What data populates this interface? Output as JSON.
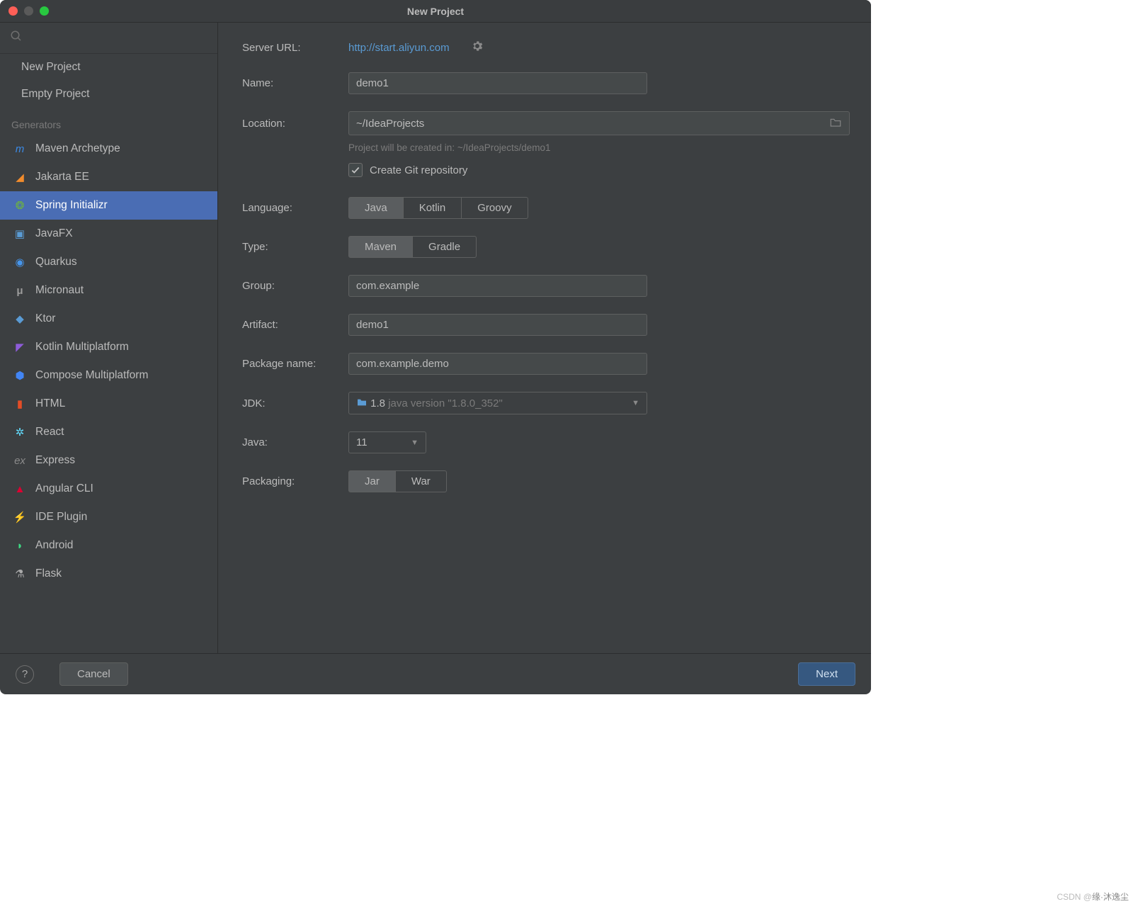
{
  "title": "New Project",
  "traffic_colors": {
    "close": "#ff5f57",
    "min": "#5a5a5a",
    "max": "#28c840"
  },
  "sidebar": {
    "items": [
      "New Project",
      "Empty Project"
    ],
    "generators_label": "Generators",
    "generators": [
      {
        "label": "Maven Archetype",
        "icon_color": "#3b8ae6",
        "glyph": "m",
        "italic": true
      },
      {
        "label": "Jakarta EE",
        "icon_color": "#f28c2c",
        "glyph": "◢"
      },
      {
        "label": "Spring Initializr",
        "icon_color": "#6db33f",
        "glyph": "❂",
        "selected": true
      },
      {
        "label": "JavaFX",
        "icon_color": "#5a9bd4",
        "glyph": "▣"
      },
      {
        "label": "Quarkus",
        "icon_color": "#4695eb",
        "glyph": "◉"
      },
      {
        "label": "Micronaut",
        "icon_color": "#9b9b9b",
        "glyph": "μ",
        "bold": true
      },
      {
        "label": "Ktor",
        "icon_color": "#5a9bd4",
        "glyph": "◆"
      },
      {
        "label": "Kotlin Multiplatform",
        "icon_color": "#8e5cd9",
        "glyph": "◤"
      },
      {
        "label": "Compose Multiplatform",
        "icon_color": "#4285f4",
        "glyph": "⬢"
      },
      {
        "label": "HTML",
        "icon_color": "#e44d26",
        "glyph": "▮"
      },
      {
        "label": "React",
        "icon_color": "#61dafb",
        "glyph": "✲"
      },
      {
        "label": "Express",
        "icon_color": "#8a8a8a",
        "glyph": "ex",
        "italic": true
      },
      {
        "label": "Angular CLI",
        "icon_color": "#dd0031",
        "glyph": "▲"
      },
      {
        "label": "IDE Plugin",
        "icon_color": "#aaa",
        "glyph": "⚡"
      },
      {
        "label": "Android",
        "icon_color": "#3ddc84",
        "glyph": "◗"
      },
      {
        "label": "Flask",
        "icon_color": "#aaa",
        "glyph": "⚗"
      }
    ]
  },
  "form": {
    "server_url_label": "Server URL:",
    "server_url_value": "http://start.aliyun.com",
    "name_label": "Name:",
    "name_value": "demo1",
    "location_label": "Location:",
    "location_value": "~/IdeaProjects",
    "location_hint": "Project will be created in: ~/IdeaProjects/demo1",
    "create_git_label": "Create Git repository",
    "create_git_checked": true,
    "language_label": "Language:",
    "language_options": [
      "Java",
      "Kotlin",
      "Groovy"
    ],
    "language_selected": "Java",
    "type_label": "Type:",
    "type_options": [
      "Maven",
      "Gradle"
    ],
    "type_selected": "Maven",
    "group_label": "Group:",
    "group_value": "com.example",
    "artifact_label": "Artifact:",
    "artifact_value": "demo1",
    "package_label": "Package name:",
    "package_value": "com.example.demo",
    "jdk_label": "JDK:",
    "jdk_value": "1.8",
    "jdk_detail": "java version \"1.8.0_352\"",
    "java_label": "Java:",
    "java_value": "11",
    "packaging_label": "Packaging:",
    "packaging_options": [
      "Jar",
      "War"
    ],
    "packaging_selected": "Jar"
  },
  "footer": {
    "cancel": "Cancel",
    "next": "Next"
  },
  "watermark": {
    "prefix": "CSDN @",
    "name": "缘·沐逸尘"
  }
}
